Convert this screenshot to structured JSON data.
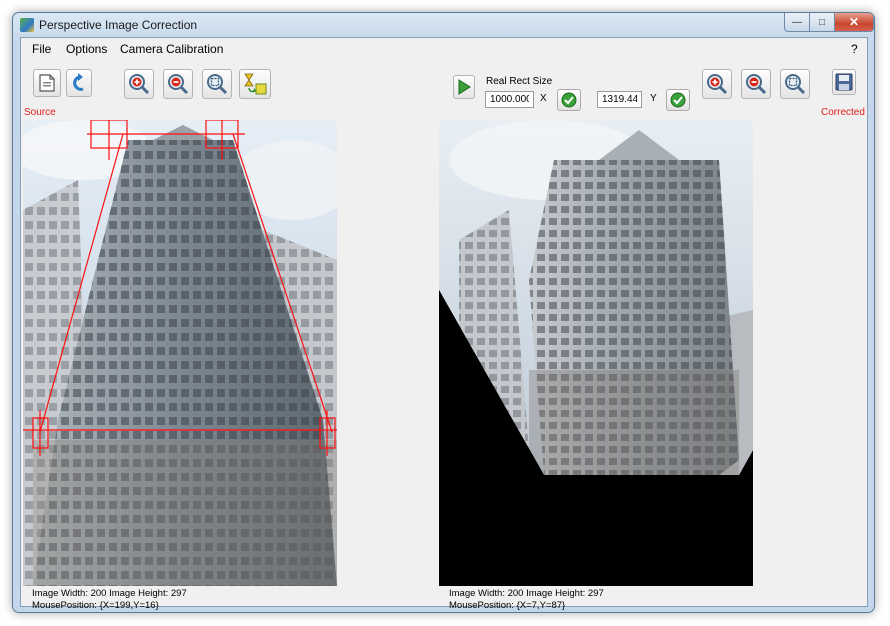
{
  "window": {
    "title": "Perspective Image Correction",
    "controls": [
      "minimize",
      "maximize",
      "close"
    ]
  },
  "menu": {
    "items": [
      "File",
      "Options",
      "Camera Calibration"
    ],
    "help": "?"
  },
  "left_toolbar": {
    "buttons": [
      "open-file-icon",
      "rotate-icon",
      "zoom-in-icon",
      "zoom-out-icon",
      "zoom-fit-icon",
      "transform-icon"
    ],
    "source_label": "Source"
  },
  "right_toolbar": {
    "play_button": "play-icon",
    "real_rect_label": "Real Rect Size",
    "x_value": "1000.000",
    "x_label": "X",
    "y_value": "1319.444",
    "y_label": "Y",
    "buttons": [
      "confirm-icon",
      "zoom-in-icon",
      "zoom-out-icon",
      "zoom-fit-icon",
      "save-icon"
    ],
    "corrected_label": "Corrected"
  },
  "source_panel": {
    "info_line1": "Image Width: 200 Image Height: 297",
    "info_line2": "MousePosition: {X=199,Y=16}"
  },
  "corrected_panel": {
    "info_line1": "Image Width: 200 Image Height: 297",
    "info_line2": "MousePosition: {X=7,Y=87}"
  },
  "colors": {
    "selection_lines": "#ff1010",
    "label_red": "#e0201a",
    "background": "#f0f0f0",
    "sky": "#c8d6e4",
    "building": "#8a9298"
  }
}
